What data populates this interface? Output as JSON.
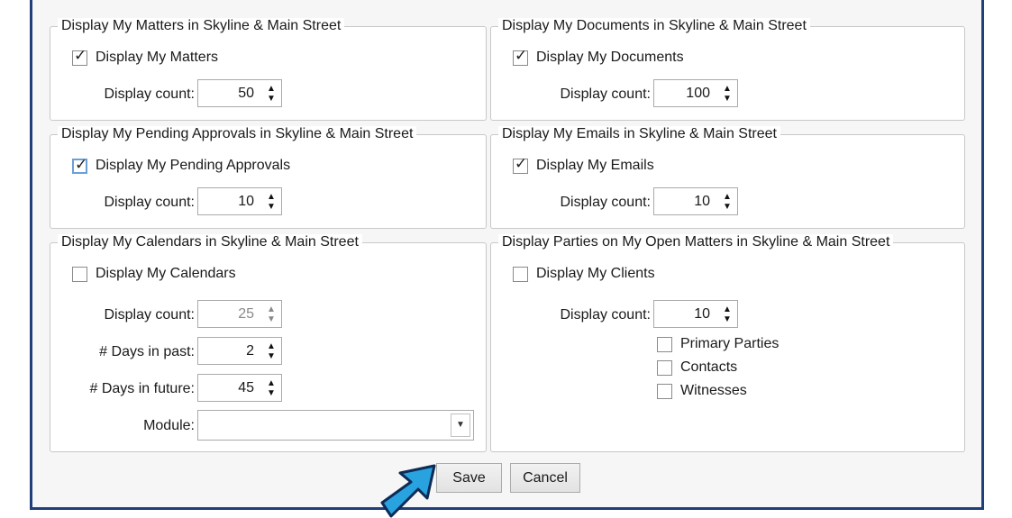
{
  "groups": {
    "matters": {
      "legend": "Display My Matters in Skyline & Main Street",
      "checkbox": "Display My Matters",
      "checked": true,
      "count_label": "Display count:",
      "count": "50"
    },
    "documents": {
      "legend": "Display My Documents in Skyline & Main Street",
      "checkbox": "Display My Documents",
      "checked": true,
      "count_label": "Display count:",
      "count": "100"
    },
    "approvals": {
      "legend": "Display My Pending Approvals in Skyline & Main Street",
      "checkbox": "Display My Pending Approvals",
      "checked": true,
      "count_label": "Display count:",
      "count": "10"
    },
    "emails": {
      "legend": "Display My Emails in Skyline & Main Street",
      "checkbox": "Display My Emails",
      "checked": true,
      "count_label": "Display count:",
      "count": "10"
    },
    "calendars": {
      "legend": "Display My Calendars in Skyline & Main Street",
      "checkbox": "Display My Calendars",
      "checked": false,
      "count_label": "Display count:",
      "count": "25",
      "past_label": "# Days in past:",
      "past": "2",
      "future_label": "# Days in future:",
      "future": "45",
      "module_label": "Module:",
      "module_value": ""
    },
    "parties": {
      "legend": "Display Parties on My Open Matters in Skyline & Main Street",
      "checkbox": "Display My Clients",
      "checked": false,
      "count_label": "Display count:",
      "count": "10",
      "options": [
        "Primary Parties",
        "Contacts",
        "Witnesses"
      ]
    }
  },
  "buttons": {
    "save": "Save",
    "cancel": "Cancel"
  },
  "icons": {
    "check": "✓",
    "up": "▲",
    "down": "▼",
    "pointer": "blue-arrow-pointer"
  },
  "colors": {
    "frame": "#1f3e7a",
    "pointer": "#29a3e0"
  }
}
